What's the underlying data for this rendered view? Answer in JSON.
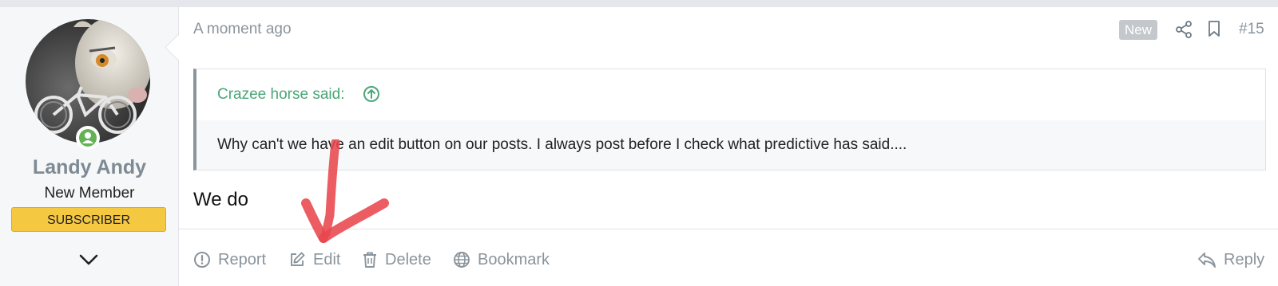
{
  "post": {
    "time": "A moment ago",
    "new_badge": "New",
    "number": "#15",
    "body": "We do"
  },
  "author": {
    "name": "Landy Andy",
    "title": "New Member",
    "banner": "SUBSCRIBER"
  },
  "quote": {
    "author": "Crazee horse said:",
    "text": "Why can't we have an edit button on our posts. I always post before I check what predictive has said...."
  },
  "actions": {
    "report": "Report",
    "edit": "Edit",
    "delete": "Delete",
    "bookmark": "Bookmark",
    "reply": "Reply"
  },
  "colors": {
    "accent_green": "#4aa678",
    "muted_text": "#8a949c",
    "banner_yellow": "#f5c842",
    "online_green": "#63b354",
    "annotation_red": "#e8474d"
  },
  "icons": {
    "share": "share-icon",
    "bookmark": "bookmark-icon",
    "quote_jump": "arrow-up-circle-icon",
    "report": "exclamation-circle-icon",
    "edit": "pencil-square-icon",
    "delete": "trash-icon",
    "bookmark_action": "globe-icon",
    "reply": "reply-arrow-icon",
    "expand": "chevron-down-icon"
  }
}
